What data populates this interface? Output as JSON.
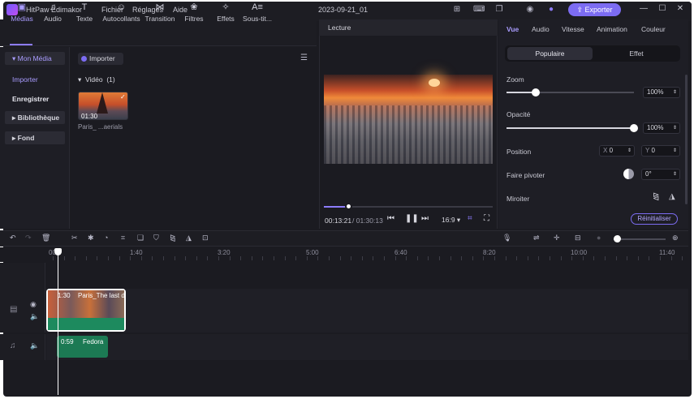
{
  "app": {
    "name": "HitPaw Edimakor",
    "project_title": "2023-09-21_01",
    "export_label": "Exporter"
  },
  "menu": [
    "Fichier",
    "Réglages",
    "Aide"
  ],
  "toolbar": [
    {
      "label": "Médias",
      "icon": "media-icon",
      "glyph": "▣"
    },
    {
      "label": "Audio",
      "icon": "music-note-icon",
      "glyph": "♫"
    },
    {
      "label": "Texte",
      "icon": "text-icon",
      "glyph": "T"
    },
    {
      "label": "Autocollants",
      "icon": "sticker-icon",
      "glyph": "☺"
    },
    {
      "label": "Transition",
      "icon": "transition-icon",
      "glyph": "⋈"
    },
    {
      "label": "Filtres",
      "icon": "filters-icon",
      "glyph": "❀"
    },
    {
      "label": "Effets",
      "icon": "effects-icon",
      "glyph": "✧"
    },
    {
      "label": "Sous-tit...",
      "icon": "subtitles-icon",
      "glyph": "A≡"
    }
  ],
  "sidebar": {
    "my_media": "Mon Média",
    "import": "Importer",
    "record": "Enregistrer",
    "library": "Bibliothèque",
    "background": "Fond"
  },
  "media_panel": {
    "import_label": "Importer",
    "section_label": "Vidéo",
    "section_count": "(1)",
    "clip_duration": "01:30",
    "clip_name": "Paris_ ...aerials"
  },
  "preview": {
    "header": "Lecture",
    "current_time": "00:13:21",
    "total_time": "/ 01:30:13",
    "ratio": "16:9",
    "progress_fraction": 0.14
  },
  "properties": {
    "tabs": [
      "Vue",
      "Audio",
      "Vitesse",
      "Animation",
      "Couleur"
    ],
    "segments": [
      "Populaire",
      "Effet"
    ],
    "zoom_label": "Zoom",
    "zoom_value": "100%",
    "zoom_fraction": 0.23,
    "opacity_label": "Opacité",
    "opacity_value": "100%",
    "opacity_fraction": 1.0,
    "position_label": "Position",
    "pos_x_label": "X",
    "pos_x_value": "0",
    "pos_y_label": "Y",
    "pos_y_value": "0",
    "rotate_label": "Faire pivoter",
    "rotate_value": "0°",
    "mirror_label": "Miroiter",
    "reset_label": "Réinitialiser"
  },
  "timeline": {
    "ruler_labels": [
      "00",
      "1:40",
      "3:20",
      "5:00",
      "6:40",
      "8:20",
      "10:00",
      "11:40"
    ],
    "video_clip": {
      "duration": "1:30",
      "name": "Paris_The last d"
    },
    "audio_clip": {
      "duration": "0:59",
      "name": "Fedora"
    },
    "zoom_fraction": 0.08
  },
  "colors": {
    "accent": "#7c6cf2",
    "clip_green": "#1d8a5e"
  }
}
